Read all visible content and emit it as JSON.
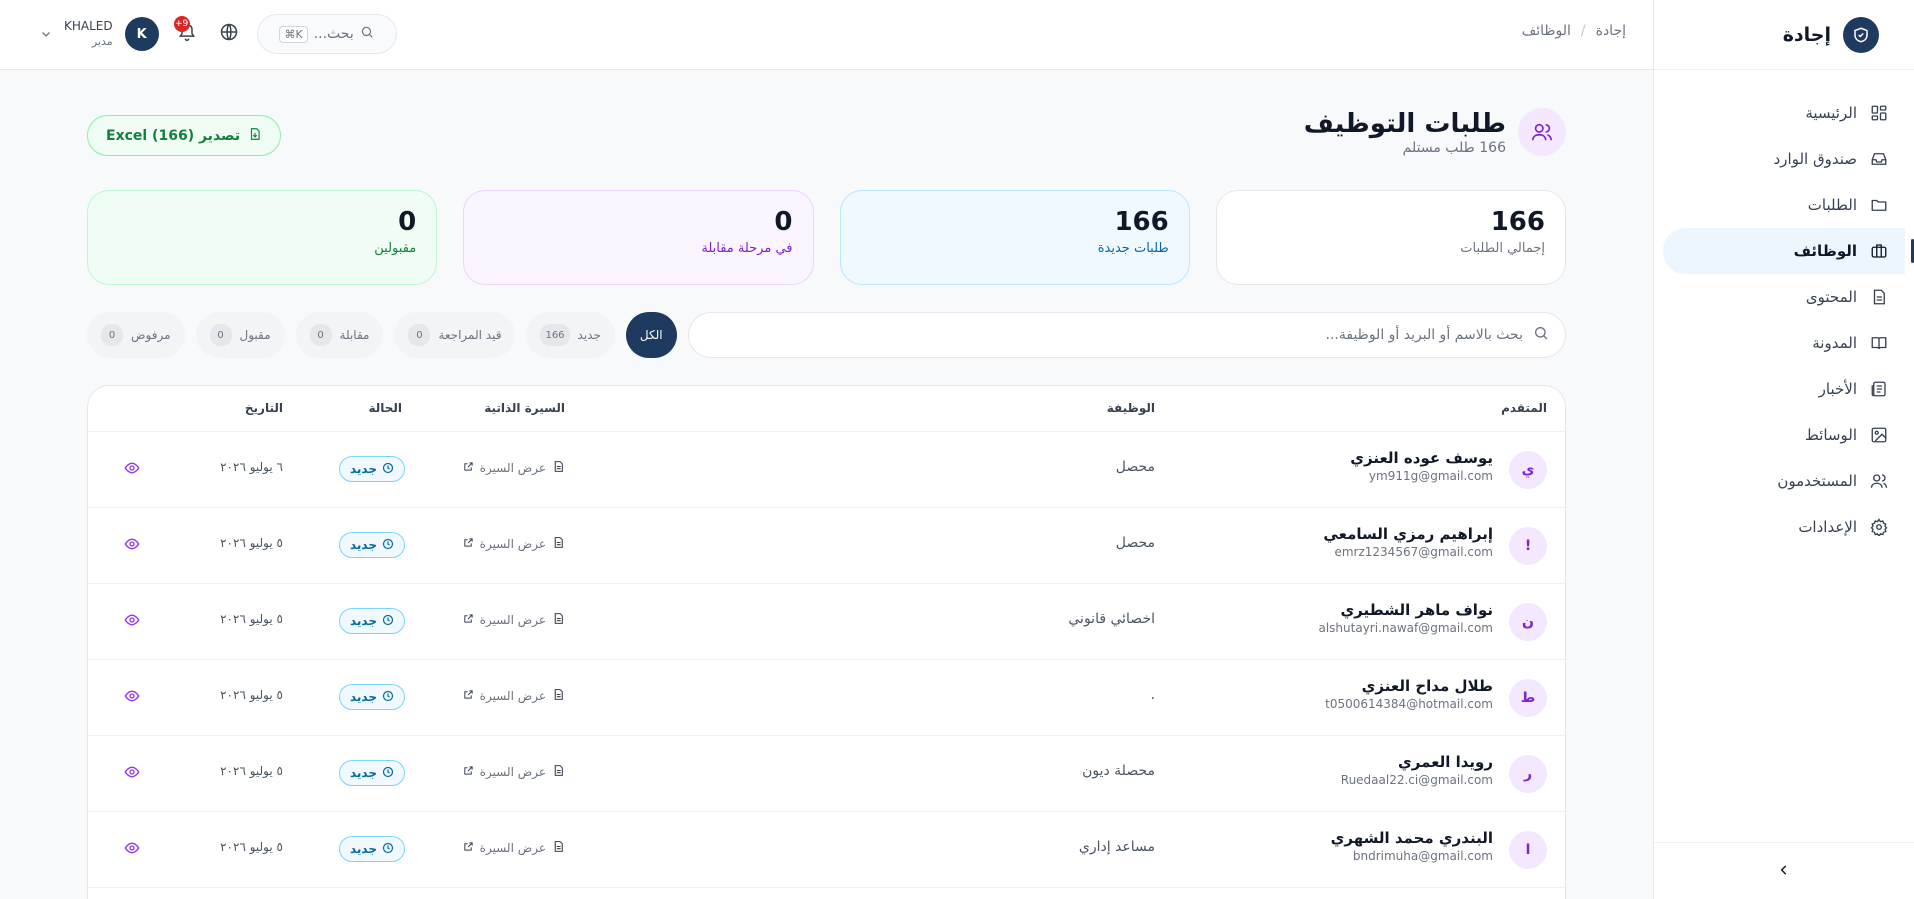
{
  "brand": {
    "name": "إجادة"
  },
  "sidebar": {
    "items": [
      {
        "label": "الرئيسية",
        "icon": "dashboard-icon"
      },
      {
        "label": "صندوق الوارد",
        "icon": "inbox-icon"
      },
      {
        "label": "الطلبات",
        "icon": "folder-icon"
      },
      {
        "label": "الوظائف",
        "icon": "briefcase-icon",
        "active": true
      },
      {
        "label": "المحتوى",
        "icon": "document-icon"
      },
      {
        "label": "المدونة",
        "icon": "book-icon"
      },
      {
        "label": "الأخبار",
        "icon": "newspaper-icon"
      },
      {
        "label": "الوسائط",
        "icon": "image-icon"
      },
      {
        "label": "المستخدمون",
        "icon": "users-icon"
      },
      {
        "label": "الإعدادات",
        "icon": "gear-icon"
      }
    ]
  },
  "header": {
    "breadcrumb": [
      "إجادة",
      "الوظائف"
    ],
    "search_placeholder": "بحث...",
    "search_shortcut": "⌘K",
    "notifications_badge": "+9",
    "user": {
      "name": "KHALED",
      "role": "مدير",
      "initial": "K"
    }
  },
  "page": {
    "title": "طلبات التوظيف",
    "subtitle": "166 طلب مستلم",
    "export_label": "تصدير (166) Excel"
  },
  "stats": [
    {
      "value": "166",
      "label": "إجمالي الطلبات",
      "variant": "plain"
    },
    {
      "value": "166",
      "label": "طلبات جديدة",
      "variant": "blue"
    },
    {
      "value": "0",
      "label": "في مرحلة مقابلة",
      "variant": "purple"
    },
    {
      "value": "0",
      "label": "مقبولين",
      "variant": "green"
    }
  ],
  "filters": {
    "search_placeholder": "بحث بالاسم أو البريد أو الوظيفة...",
    "tabs": [
      {
        "label": "الكل",
        "count": "",
        "active": true
      },
      {
        "label": "جديد",
        "count": "166"
      },
      {
        "label": "قيد المراجعة",
        "count": "0"
      },
      {
        "label": "مقابلة",
        "count": "0"
      },
      {
        "label": "مقبول",
        "count": "0"
      },
      {
        "label": "مرفوض",
        "count": "0"
      }
    ]
  },
  "table": {
    "headers": {
      "applicant": "المتقدم",
      "job": "الوظيفة",
      "cv": "السيرة الذاتية",
      "status": "الحالة",
      "date": "التاريخ"
    },
    "cv_link_label": "عرض السيرة",
    "status_label": "جديد",
    "rows": [
      {
        "initial": "ي",
        "name": "يوسف عوده العنزي",
        "email": "ym911g@gmail.com",
        "job": "محصل",
        "date": "٦ يوليو ٢٠٢٦"
      },
      {
        "initial": "!",
        "name": "إبراهيم رمزي السامعي",
        "email": "emrz1234567@gmail.com",
        "job": "محصل",
        "date": "٥ يوليو ٢٠٢٦"
      },
      {
        "initial": "ن",
        "name": "نواف ماهر الشطيري",
        "email": "alshutayri.nawaf@gmail.com",
        "job": "اخصائي قانوني",
        "date": "٥ يوليو ٢٠٢٦"
      },
      {
        "initial": "ط",
        "name": "طلال مداح العنزي",
        "email": "t0500614384@hotmail.com",
        "job": ".",
        "date": "٥ يوليو ٢٠٢٦"
      },
      {
        "initial": "ر",
        "name": "رويدا العمري",
        "email": "Ruedaal22.ci@gmail.com",
        "job": "محصلة ديون",
        "date": "٥ يوليو ٢٠٢٦"
      },
      {
        "initial": "ا",
        "name": "البندري محمد الشهري",
        "email": "bndrimuha@gmail.com",
        "job": "مساعد إداري",
        "date": "٥ يوليو ٢٠٢٦"
      }
    ]
  }
}
